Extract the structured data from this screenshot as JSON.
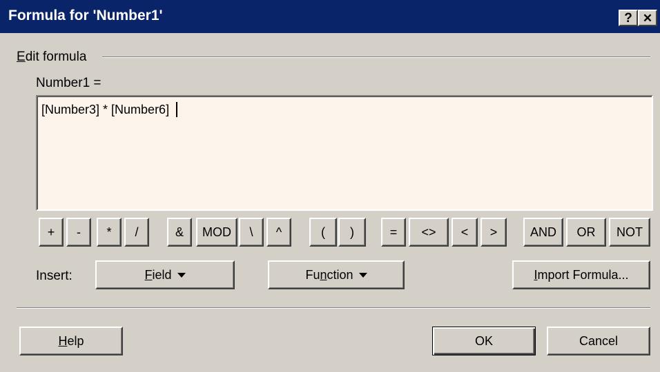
{
  "window": {
    "title": "Formula for 'Number1'",
    "help_glyph": "?",
    "close_glyph": "✕"
  },
  "group": {
    "label_mnemonic": "E",
    "label_rest": "dit formula"
  },
  "field_label": "Number1 =",
  "formula_value": "[Number3] * [Number6]",
  "operators": [
    "+",
    "-",
    "*",
    "/",
    "&",
    "MOD",
    "\\",
    "^",
    "(",
    ")",
    "=",
    "<>",
    "<",
    ">",
    "AND",
    "OR",
    "NOT"
  ],
  "insert": {
    "label": "Insert:",
    "field_mnemonic": "F",
    "field_rest": "ield",
    "function_pre": "Fu",
    "function_mnemonic": "n",
    "function_rest": "ction",
    "import_mnemonic": "I",
    "import_rest": "mport Formula..."
  },
  "buttons": {
    "help_mnemonic": "H",
    "help_rest": "elp",
    "ok": "OK",
    "cancel": "Cancel"
  },
  "colors": {
    "titlebar": "#0a246a",
    "dialog_bg": "#d4d0c8",
    "formula_bg": "#fdf5ec"
  }
}
